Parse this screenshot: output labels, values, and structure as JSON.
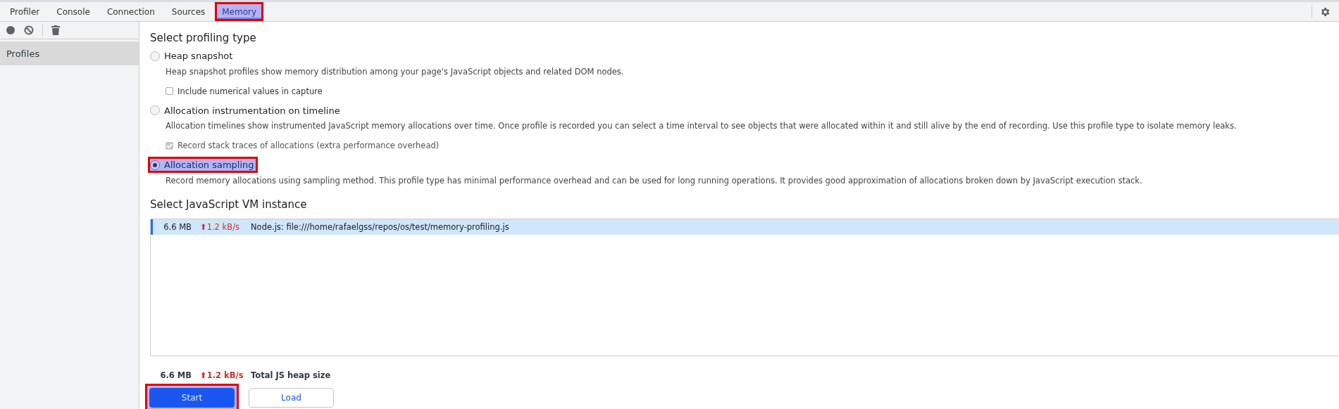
{
  "tabs": [
    {
      "label": "Profiler",
      "selected": false,
      "highlighted": false
    },
    {
      "label": "Console",
      "selected": false,
      "highlighted": false
    },
    {
      "label": "Connection",
      "selected": false,
      "highlighted": false
    },
    {
      "label": "Sources",
      "selected": false,
      "highlighted": false
    },
    {
      "label": "Memory",
      "selected": true,
      "highlighted": true
    }
  ],
  "sidebar": {
    "items": [
      {
        "label": "Profiles",
        "selected": true
      }
    ]
  },
  "profiling_type": {
    "heading": "Select profiling type",
    "options": [
      {
        "label": "Heap snapshot",
        "selected": false,
        "highlighted": false,
        "description": "Heap snapshot profiles show memory distribution among your page's JavaScript objects and related DOM nodes.",
        "checkbox": {
          "label": "Include numerical values in capture",
          "checked": false,
          "disabled": false
        }
      },
      {
        "label": "Allocation instrumentation on timeline",
        "selected": false,
        "highlighted": false,
        "description": "Allocation timelines show instrumented JavaScript memory allocations over time. Once profile is recorded you can select a time interval to see objects that were allocated within it and still alive by the end of recording. Use this profile type to isolate memory leaks.",
        "checkbox": {
          "label": "Record stack traces of allocations (extra performance overhead)",
          "checked": true,
          "disabled": true
        }
      },
      {
        "label": "Allocation sampling",
        "selected": true,
        "highlighted": true,
        "description": "Record memory allocations using sampling method. This profile type has minimal performance overhead and can be used for long running operations. It provides good approximation of allocations broken down by JavaScript execution stack."
      }
    ]
  },
  "vm_instance": {
    "heading": "Select JavaScript VM instance",
    "rows": [
      {
        "size": "6.6 MB",
        "rate": "⬆1.2 kB/s",
        "name": "Node.js: file:///home/rafaelgss/repos/os/test/memory-profiling.js",
        "selected": true
      }
    ]
  },
  "summary": {
    "size": "6.6 MB",
    "rate": "⬆1.2 kB/s",
    "label": "Total JS heap size"
  },
  "buttons": [
    {
      "label": "Start",
      "kind": "primary",
      "highlighted": true
    },
    {
      "label": "Load",
      "kind": "secondary",
      "highlighted": false
    }
  ]
}
